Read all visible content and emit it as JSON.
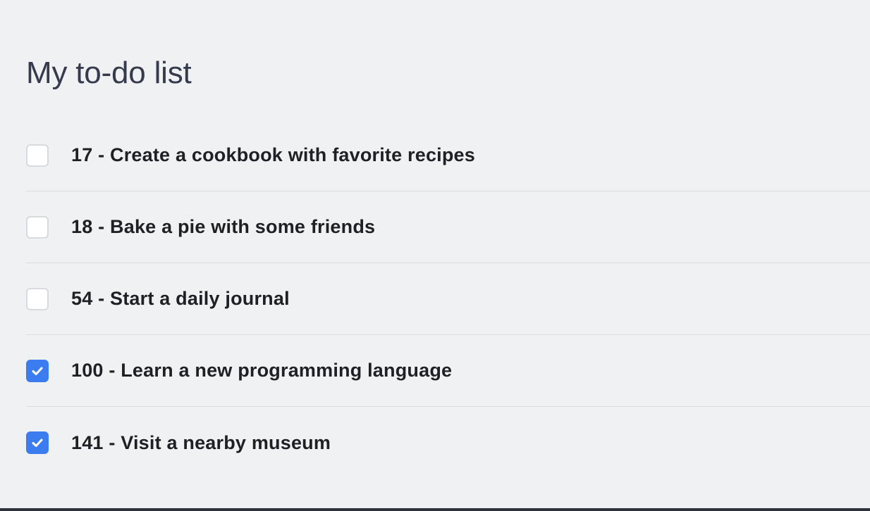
{
  "page": {
    "title": "My to-do list"
  },
  "todos": [
    {
      "label": "17 - Create a cookbook with favorite recipes",
      "checked": false
    },
    {
      "label": "18 - Bake a pie with some friends",
      "checked": false
    },
    {
      "label": "54 - Start a daily journal",
      "checked": false
    },
    {
      "label": "100 - Learn a new programming language",
      "checked": true
    },
    {
      "label": "141 - Visit a nearby museum",
      "checked": true
    }
  ],
  "colors": {
    "background": "#f0f1f3",
    "title": "#353b4d",
    "text": "#1f2023",
    "checkbox_checked": "#3b7cf0",
    "checkbox_border": "#d9dade",
    "divider": "#dcdde0"
  },
  "icons": {
    "checkmark": "check-icon"
  }
}
